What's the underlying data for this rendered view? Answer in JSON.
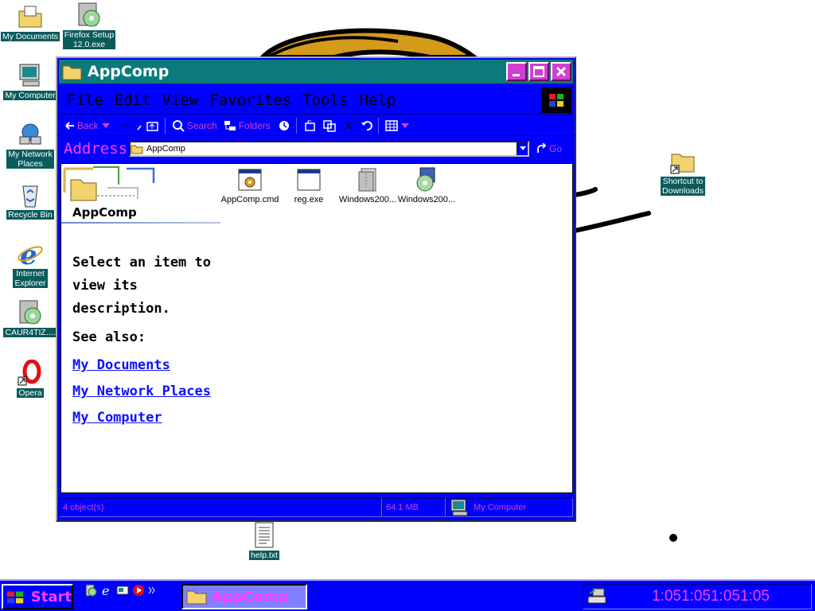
{
  "desktop": {
    "icons": [
      {
        "label": "My Documents",
        "icon": "folder-documents-icon"
      },
      {
        "label": "Firefox Setup\n12.0.exe",
        "icon": "installer-cd-icon"
      },
      {
        "label": "My Computer",
        "icon": "computer-icon"
      },
      {
        "label": "My Network\nPlaces",
        "icon": "network-icon"
      },
      {
        "label": "Recycle Bin",
        "icon": "recycle-bin-icon"
      },
      {
        "label": "Internet\nExplorer",
        "icon": "ie-icon"
      },
      {
        "label": "CAUR4TIZ....",
        "icon": "installer-cd-icon"
      },
      {
        "label": "Opera",
        "icon": "opera-icon"
      },
      {
        "label": "Shortcut to\nDownloads",
        "icon": "folder-shortcut-icon"
      },
      {
        "label": "help.txt",
        "icon": "text-file-icon"
      }
    ]
  },
  "window": {
    "title": "AppComp",
    "menu": [
      "File",
      "Edit",
      "View",
      "Favorites",
      "Tools",
      "Help"
    ],
    "toolbar": {
      "back": "Back",
      "search": "Search",
      "folders": "Folders"
    },
    "address": {
      "label": "Address",
      "value": "AppComp",
      "go": "Go"
    },
    "webview": {
      "folder_title": "AppComp",
      "description": "Select an item to view its description.",
      "see_also": "See also:",
      "links": [
        "My Documents",
        "My Network Places",
        "My Computer"
      ]
    },
    "files": [
      {
        "name": "AppComp.cmd",
        "icon": "cmd-script-icon"
      },
      {
        "name": "reg.exe",
        "icon": "application-window-icon"
      },
      {
        "name": "Windows200...",
        "icon": "archive-file-icon"
      },
      {
        "name": "Windows200...",
        "icon": "installer-cd-icon"
      }
    ],
    "status": {
      "objects": "4 object(s)",
      "size": "64.1 MB",
      "zone": "My Computer"
    }
  },
  "taskbar": {
    "start": "Start",
    "task": "AppComp",
    "clock": "1:051:051:051:05"
  },
  "colors": {
    "window_bg": "#0000ff",
    "titlebar": "#0b7a7a",
    "accent": "#ff40ff",
    "desktop_label_bg": "#0a5b5b"
  }
}
